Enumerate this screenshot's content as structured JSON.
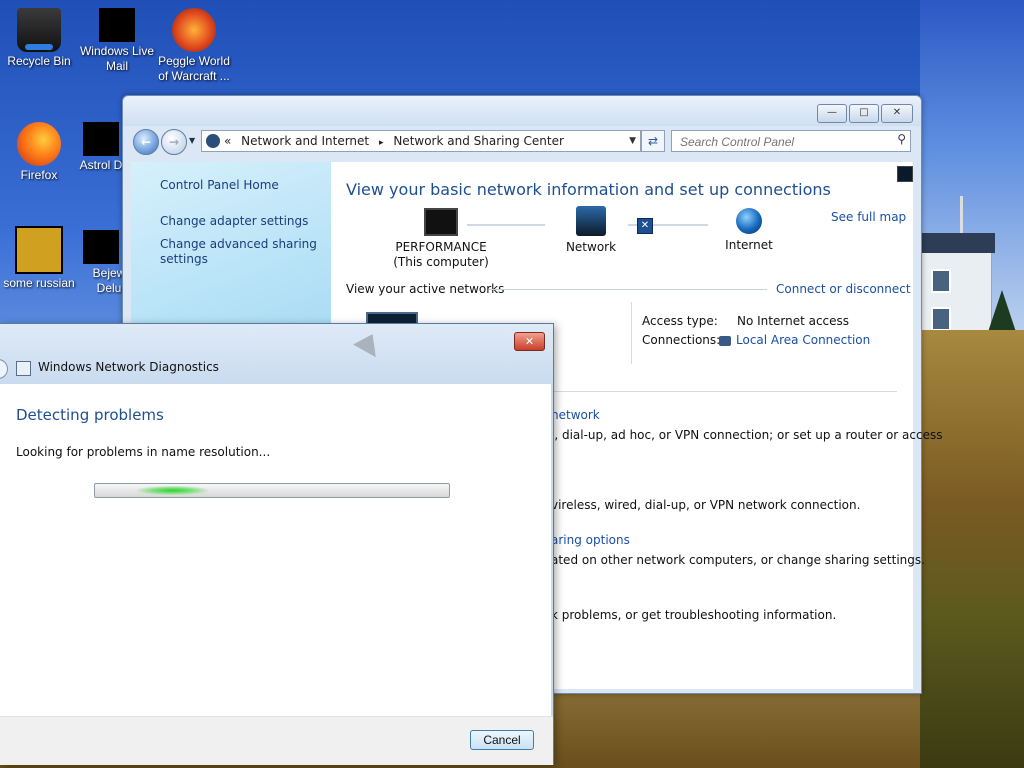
{
  "desktop": {
    "icons": [
      {
        "label": "Recycle Bin",
        "icon": "recycle-bin-icon"
      },
      {
        "label": "Windows Live Mail",
        "icon": "windows-live-mail-icon"
      },
      {
        "label": "Peggle World of Warcraft ...",
        "icon": "peggle-icon"
      },
      {
        "label": "Firefox",
        "icon": "firefox-icon"
      },
      {
        "label": "Astrol Delu",
        "icon": "astrol-icon"
      },
      {
        "label": "some russian",
        "icon": "ie-icon"
      },
      {
        "label": "Bejew Delu",
        "icon": "bejeweled-icon"
      }
    ]
  },
  "nsc": {
    "address": {
      "crumbs": [
        "Network and Internet",
        "Network and Sharing Center"
      ],
      "recent_glyph": "«",
      "separator": "▸"
    },
    "search": {
      "placeholder": "Search Control Panel"
    },
    "left_pane": {
      "home": "Control Panel Home",
      "links": [
        "Change adapter settings",
        "Change advanced sharing settings"
      ]
    },
    "heading": "View your basic network information and set up connections",
    "see_full_map": "See full map",
    "map": {
      "computer": "PERFORMANCE",
      "computer_sub": "(This computer)",
      "network": "Network",
      "internet": "Internet"
    },
    "active_networks": {
      "title": "View your active networks",
      "connect": "Connect or disconnect",
      "access_type_label": "Access type:",
      "access_type_value": "No Internet access",
      "connections_label": "Connections:",
      "connections_value": "Local Area Connection"
    },
    "tasks": [
      {
        "link": "network",
        "desc": "l, dial-up, ad hoc, or VPN connection; or set up a router or access"
      },
      {
        "desc": "vireless, wired, dial-up, or VPN network connection."
      },
      {
        "link": "aring options",
        "desc": "ated on other network computers, or change sharing settings."
      },
      {
        "desc": "k problems, or get troubleshooting information."
      }
    ]
  },
  "wnd": {
    "title": "Windows Network Diagnostics",
    "close_glyph": "✕",
    "heading": "Detecting problems",
    "status": "Looking for problems in name resolution...",
    "progress": 0.2,
    "cancel": "Cancel"
  }
}
